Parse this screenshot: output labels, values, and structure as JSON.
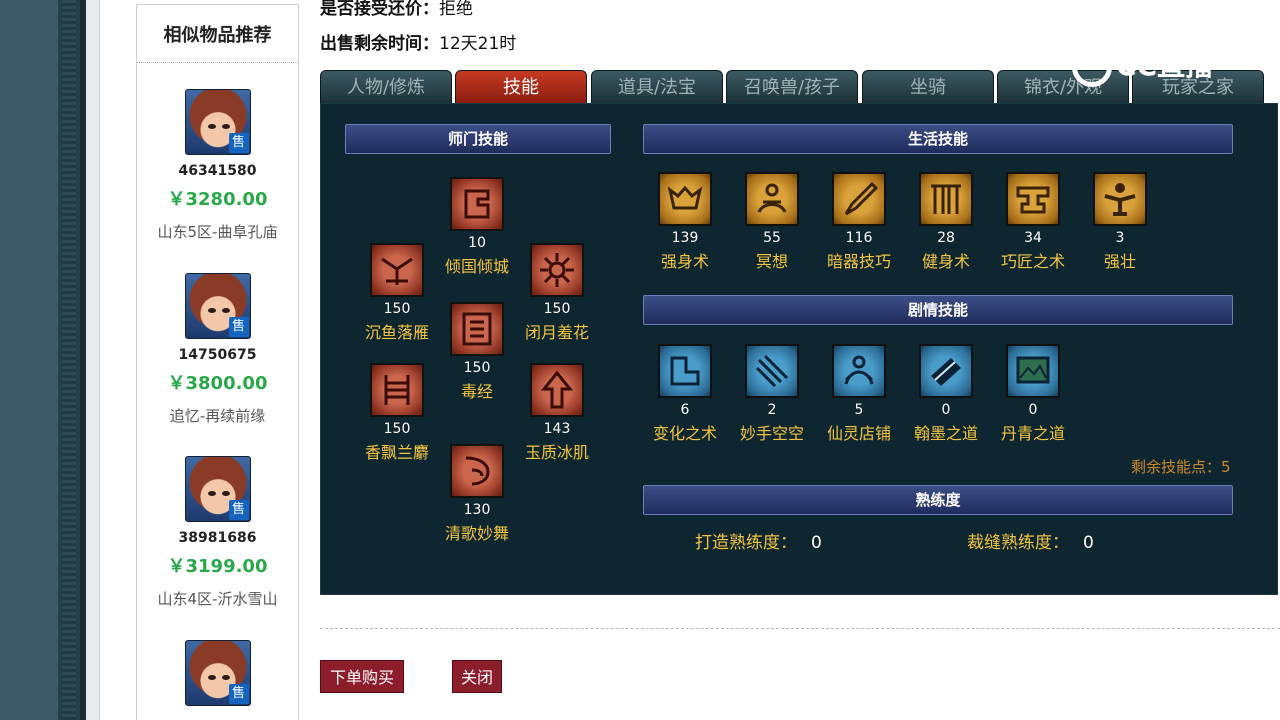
{
  "header": {
    "counter_offer_label": "是否接受还价：",
    "counter_offer_value": "拒绝",
    "time_left_label": "出售剩余时间：",
    "time_left_value": "12天21时"
  },
  "sidebar": {
    "title": "相似物品推荐",
    "sale_tag": "售",
    "items": [
      {
        "id": "46341580",
        "price": "￥3280.00",
        "server": "山东5区-曲阜孔庙"
      },
      {
        "id": "14750675",
        "price": "￥3800.00",
        "server": "追忆-再续前缘"
      },
      {
        "id": "38981686",
        "price": "￥3199.00",
        "server": "山东4区-沂水雪山"
      }
    ]
  },
  "tabs": [
    "人物/修炼",
    "技能",
    "道具/法宝",
    "召唤兽/孩子",
    "坐骑",
    "锦衣/外观",
    "玩家之家"
  ],
  "active_tab": "技能",
  "panel": {
    "school_title": "师门技能",
    "life_title": "生活技能",
    "story_title": "剧情技能",
    "prof_title": "熟练度",
    "school_skills": [
      {
        "level": "10",
        "name": "倾国倾城",
        "icon": "kneeling-figure-icon"
      },
      {
        "level": "150",
        "name": "沉鱼落雁",
        "icon": "phoenix-icon"
      },
      {
        "level": "150",
        "name": "闭月羞花",
        "icon": "flower-icon"
      },
      {
        "level": "150",
        "name": "毒经",
        "icon": "scroll-icon"
      },
      {
        "level": "150",
        "name": "香飘兰麝",
        "icon": "orchid-icon"
      },
      {
        "level": "143",
        "name": "玉质冰肌",
        "icon": "arrow-up-icon"
      },
      {
        "level": "130",
        "name": "清歌妙舞",
        "icon": "dancer-icon"
      }
    ],
    "life_skills": [
      {
        "level": "139",
        "name": "强身术",
        "icon": "muscle-icon"
      },
      {
        "level": "55",
        "name": "冥想",
        "icon": "meditate-icon"
      },
      {
        "level": "116",
        "name": "暗器技巧",
        "icon": "dagger-icon"
      },
      {
        "level": "28",
        "name": "健身术",
        "icon": "pillars-icon"
      },
      {
        "level": "34",
        "name": "巧匠之术",
        "icon": "anvil-icon"
      },
      {
        "level": "3",
        "name": "强壮",
        "icon": "strongman-icon"
      }
    ],
    "story_skills": [
      {
        "level": "6",
        "name": "变化之术",
        "icon": "transform-icon"
      },
      {
        "level": "2",
        "name": "妙手空空",
        "icon": "claw-icon"
      },
      {
        "level": "5",
        "name": "仙灵店铺",
        "icon": "shop-icon"
      },
      {
        "level": "0",
        "name": "翰墨之道",
        "icon": "book-icon"
      },
      {
        "level": "0",
        "name": "丹青之道",
        "icon": "painting-icon"
      }
    ],
    "remaining_points": "剩余技能点：5",
    "forge_label": "打造熟练度：",
    "forge_value": "0",
    "tailor_label": "裁缝熟练度：",
    "tailor_value": "0"
  },
  "buttons": {
    "buy": "下单购买",
    "close": "关闭"
  },
  "watermark": "CC直播"
}
